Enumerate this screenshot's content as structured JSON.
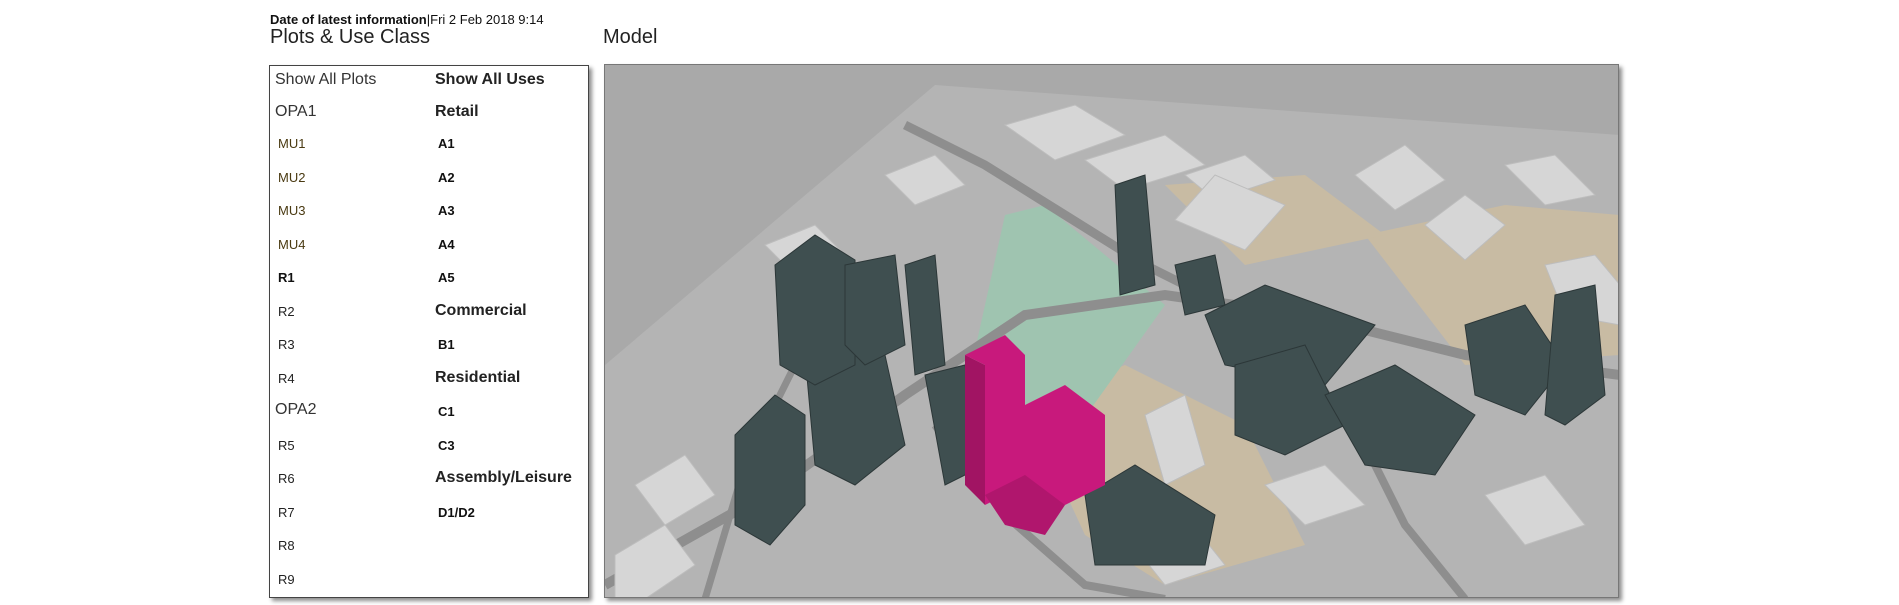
{
  "header": {
    "date_label": "Date of latest information",
    "date_separator": "|",
    "date_value": "Fri 2 Feb 2018 9:14"
  },
  "plots_panel": {
    "title": "Plots & Use Class",
    "show_all_plots": "Show All Plots",
    "show_all_uses": "Show All Uses",
    "opa1": "OPA1",
    "opa1_items": [
      "MU1",
      "MU2",
      "MU3",
      "MU4",
      "R1",
      "R2",
      "R3",
      "R4"
    ],
    "opa2": "OPA2",
    "opa2_items": [
      "R5",
      "R6",
      "R7",
      "R8",
      "R9"
    ],
    "active_plot": "R1",
    "use_categories": {
      "retail": {
        "label": "Retail",
        "items": [
          "A1",
          "A2",
          "A3",
          "A4",
          "A5"
        ]
      },
      "commercial": {
        "label": "Commercial",
        "items": [
          "B1"
        ]
      },
      "residential": {
        "label": "Residential",
        "items": [
          "C1",
          "C3"
        ]
      },
      "assembly": {
        "label": "Assembly/Leisure",
        "items": [
          "D1/D2"
        ]
      }
    }
  },
  "model": {
    "title": "Model",
    "colors": {
      "background": "#a9a9a9",
      "ground": "#b4b4b4",
      "road": "#8e8e8e",
      "sand": "#c8bba3",
      "green": "#9fc4b0",
      "building_dark": "#3f4f50",
      "building_dark_side": "#344243",
      "building_light": "#d6d6d6",
      "highlight": "#c8197c",
      "highlight_side": "#a11463"
    }
  }
}
